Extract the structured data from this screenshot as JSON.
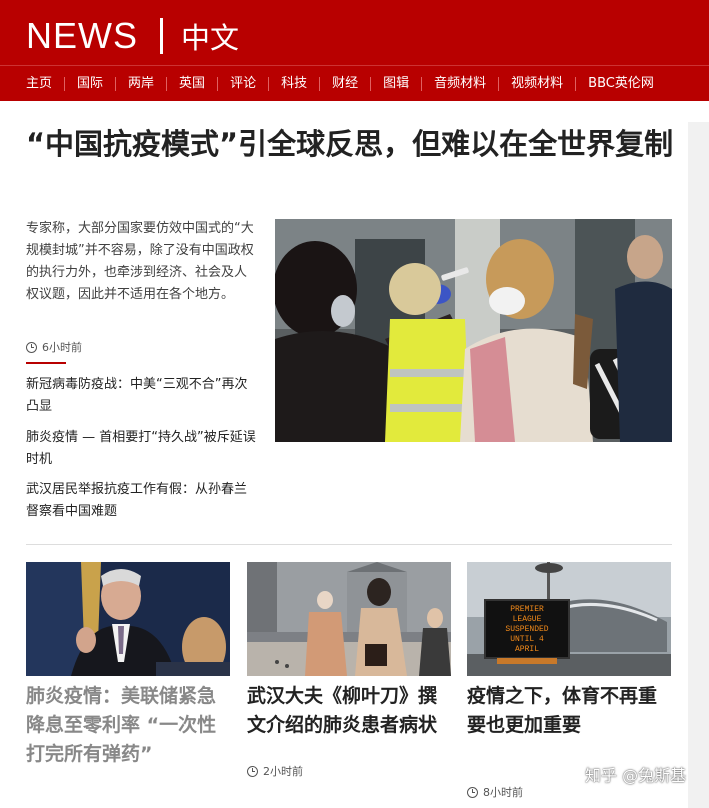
{
  "brand": {
    "news": "NEWS",
    "chinese": "中文"
  },
  "nav": [
    "主页",
    "国际",
    "两岸",
    "英国",
    "评论",
    "科技",
    "财经",
    "图辑",
    "音频材料",
    "视频材料",
    "BBC英伦网"
  ],
  "main": {
    "headline": "“中国抗疫模式”引全球反思，但难以在全世界复制",
    "summary": "专家称，大部分国家要仿效中国式的“大规模封城”并不容易，除了没有中国政权的执行力外，也牵涉到经济、社会及人权议题，因此并不适用在各个地方。",
    "time": "6小时前",
    "related": [
      "新冠病毒防疫战：中美“三观不合”再次凸显",
      "肺炎疫情 — 首相要打“持久战”被斥延误时机",
      "武汉居民举报抗疫工作有假：从孙春兰督察看中国难题"
    ]
  },
  "cards": [
    {
      "title": "肺炎疫情：美联储紧急降息至零利率 “一次性打完所有弹药”",
      "time": ""
    },
    {
      "title": "武汉大夫《柳叶刀》撰文介绍的肺炎患者病状",
      "time": "2小时前"
    },
    {
      "title": "疫情之下，体育不再重要也更加重要",
      "time": "8小时前"
    }
  ],
  "stadium_sign": [
    "PREMIER",
    "LEAGUE",
    "SUSPENDED",
    "UNTIL 4",
    "APRIL"
  ],
  "watermark": "知乎 @兔斯基",
  "colors": {
    "brand_red": "#b80000",
    "card_title_grey": "#888888",
    "headline": "#222222"
  }
}
